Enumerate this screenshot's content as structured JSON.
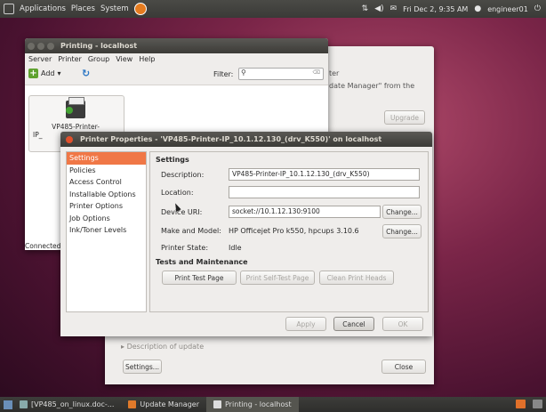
{
  "top_panel": {
    "menus": [
      "Applications",
      "Places",
      "System"
    ],
    "datetime": "Fri Dec 2, 9:35 AM",
    "user": "engineer01"
  },
  "update_manager": {
    "partial_lines": [
      "ter",
      "date Manager\" from the"
    ],
    "upgrade_button": "Upgrade",
    "description_expander": "Description of update",
    "settings_button": "Settings...",
    "close_button": "Close"
  },
  "printing_window": {
    "title": "Printing - localhost",
    "menus": [
      "Server",
      "Printer",
      "Group",
      "View",
      "Help"
    ],
    "add_label": "Add",
    "filter_label": "Filter:",
    "printer_name_line1": "VP485-Printer-",
    "printer_name_line2": "IP_",
    "status": "Connected"
  },
  "properties_dialog": {
    "title": "Printer Properties - 'VP485-Printer-IP_10.1.12.130_(drv_K550)' on localhost",
    "sidebar": [
      "Settings",
      "Policies",
      "Access Control",
      "Installable Options",
      "Printer Options",
      "Job Options",
      "Ink/Toner Levels"
    ],
    "settings_header": "Settings",
    "description_label": "Description:",
    "description_value": "VP485-Printer-IP_10.1.12.130_(drv_K550)",
    "location_label": "Location:",
    "location_value": "",
    "device_uri_label": "Device URI:",
    "device_uri_value": "socket://10.1.12.130:9100",
    "make_model_label": "Make and Model:",
    "make_model_value": "HP Officejet Pro k550, hpcups 3.10.6",
    "printer_state_label": "Printer State:",
    "printer_state_value": "Idle",
    "change_label": "Change...",
    "maintenance_header": "Tests and Maintenance",
    "print_test_page": "Print Test Page",
    "print_self_test_page": "Print Self-Test Page",
    "clean_print_heads": "Clean Print Heads",
    "apply": "Apply",
    "cancel": "Cancel",
    "ok": "OK"
  },
  "taskbar": {
    "items": [
      "[VP485_on_linux.doc-...",
      "Update Manager",
      "Printing - localhost"
    ]
  }
}
